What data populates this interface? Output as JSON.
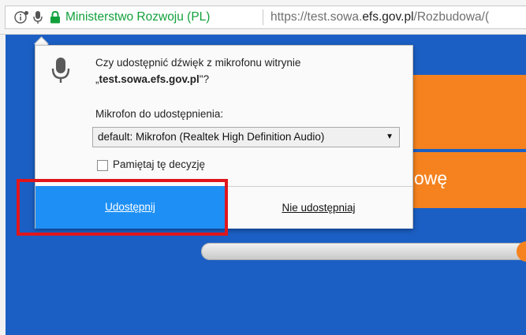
{
  "urlbar": {
    "site_identity": "Ministerstwo Rozwoju (PL)",
    "url_prefix": "https://test.sowa.",
    "url_domain": "efs.gov.pl",
    "url_suffix": "/Rozbudowa/("
  },
  "page": {
    "orange_button_text": "owę"
  },
  "popup": {
    "prompt_line1": "Czy udostępnić dźwięk z mikrofonu witrynie",
    "prompt_open_quote": "„",
    "prompt_host": "test.sowa.efs.gov.pl",
    "prompt_close": "\"?",
    "mic_label": "Mikrofon do udostępnienia:",
    "mic_selected": "default: Mikrofon (Realtek High Definition Audio)",
    "remember_label": "Pamiętaj tę decyzję",
    "remember_checked": false,
    "allow_label": "Udostępnij",
    "deny_label": "Nie udostępniaj"
  },
  "colors": {
    "page_bg": "#1b5fc4",
    "accent_orange": "#f5821f",
    "allow_blue": "#1e90f5",
    "secure_green": "#12a03b",
    "highlight_red": "#e0161d"
  }
}
